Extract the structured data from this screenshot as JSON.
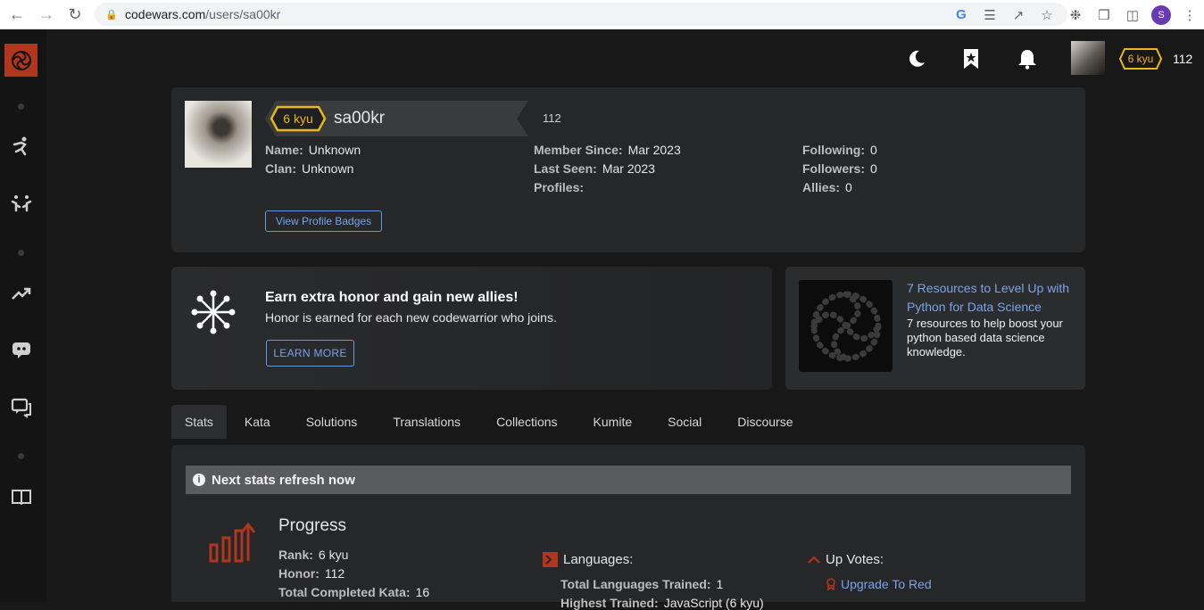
{
  "browser": {
    "url_host": "codewars.com",
    "url_path": "/users/sa00kr",
    "profile_initial": "S"
  },
  "topbar": {
    "kyu": "6 kyu",
    "honor": "112"
  },
  "profile": {
    "kyu": "6 kyu",
    "username": "sa00kr",
    "honor": "112",
    "name_label": "Name:",
    "name_value": "Unknown",
    "clan_label": "Clan:",
    "clan_value": "Unknown",
    "member_since_label": "Member Since:",
    "member_since_value": "Mar 2023",
    "last_seen_label": "Last Seen:",
    "last_seen_value": "Mar 2023",
    "profiles_label": "Profiles:",
    "following_label": "Following:",
    "following_value": "0",
    "followers_label": "Followers:",
    "followers_value": "0",
    "allies_label": "Allies:",
    "allies_value": "0",
    "badges_button": "View Profile Badges"
  },
  "promo": {
    "title": "Earn extra honor and gain new allies!",
    "subtitle": "Honor is earned for each new codewarrior who joins.",
    "button": "LEARN MORE"
  },
  "resource": {
    "link": "7 Resources to Level Up with Python for Data Science",
    "description": "7 resources to help boost your python based data science knowledge."
  },
  "tabs": [
    "Stats",
    "Kata",
    "Solutions",
    "Translations",
    "Collections",
    "Kumite",
    "Social",
    "Discourse"
  ],
  "stats": {
    "notice": "Next stats refresh now",
    "progress_title": "Progress",
    "rank_label": "Rank:",
    "rank_value": "6 kyu",
    "honor_label": "Honor:",
    "honor_value": "112",
    "completed_label": "Total Completed Kata:",
    "completed_value": "16",
    "languages_title": "Languages:",
    "langs_trained_label": "Total Languages Trained:",
    "langs_trained_value": "1",
    "highest_trained_label": "Highest Trained:",
    "highest_trained_value": "JavaScript (6 kyu)",
    "upvotes_title": "Up Votes:",
    "upgrade_link": "Upgrade To Red"
  },
  "colors": {
    "accent_red": "#b1361e",
    "kyu_yellow": "#ecb613",
    "link_blue": "#7aa3e8"
  }
}
